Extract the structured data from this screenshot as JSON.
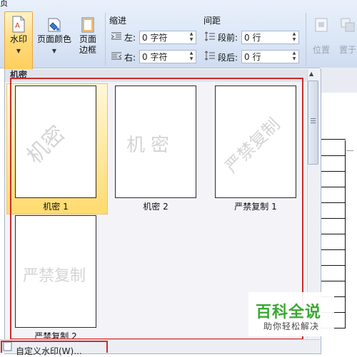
{
  "ribbon": {
    "title_fragment": "页",
    "watermark_button": "水印",
    "page_color_button": "页面颜色",
    "page_border_button": [
      "页面",
      "边框"
    ],
    "indent": {
      "label": "缩进",
      "left_label": "左:",
      "left_value": "0 字符",
      "right_label": "右:",
      "right_value": "0 字符"
    },
    "spacing": {
      "label": "间距",
      "before_label": "段前:",
      "before_value": "0 行",
      "after_label": "段后:",
      "after_value": "0 行"
    },
    "position_button": "位置",
    "wrap_button_fragment": "置于"
  },
  "gallery": {
    "section_header": "机密",
    "items": [
      {
        "caption": "机密 1",
        "watermark": "机密",
        "style": "diagonal",
        "selected": true
      },
      {
        "caption": "机密 2",
        "watermark": "机密",
        "style": "horizontal",
        "selected": false
      },
      {
        "caption": "严禁复制 1",
        "watermark": "严禁复制",
        "style": "diagonal",
        "selected": false
      },
      {
        "caption": "严禁复制 2",
        "watermark": "严禁复制",
        "style": "horizontal",
        "selected": false
      }
    ],
    "custom_item_fragment": "自定义水印(W)..."
  },
  "badge": {
    "title": "百科全说",
    "subtitle": "助你轻松解决"
  },
  "colors": {
    "highlight_red": "#cc2b2b",
    "selected_gold": "#ffd875",
    "badge_green": "#3aa832"
  }
}
